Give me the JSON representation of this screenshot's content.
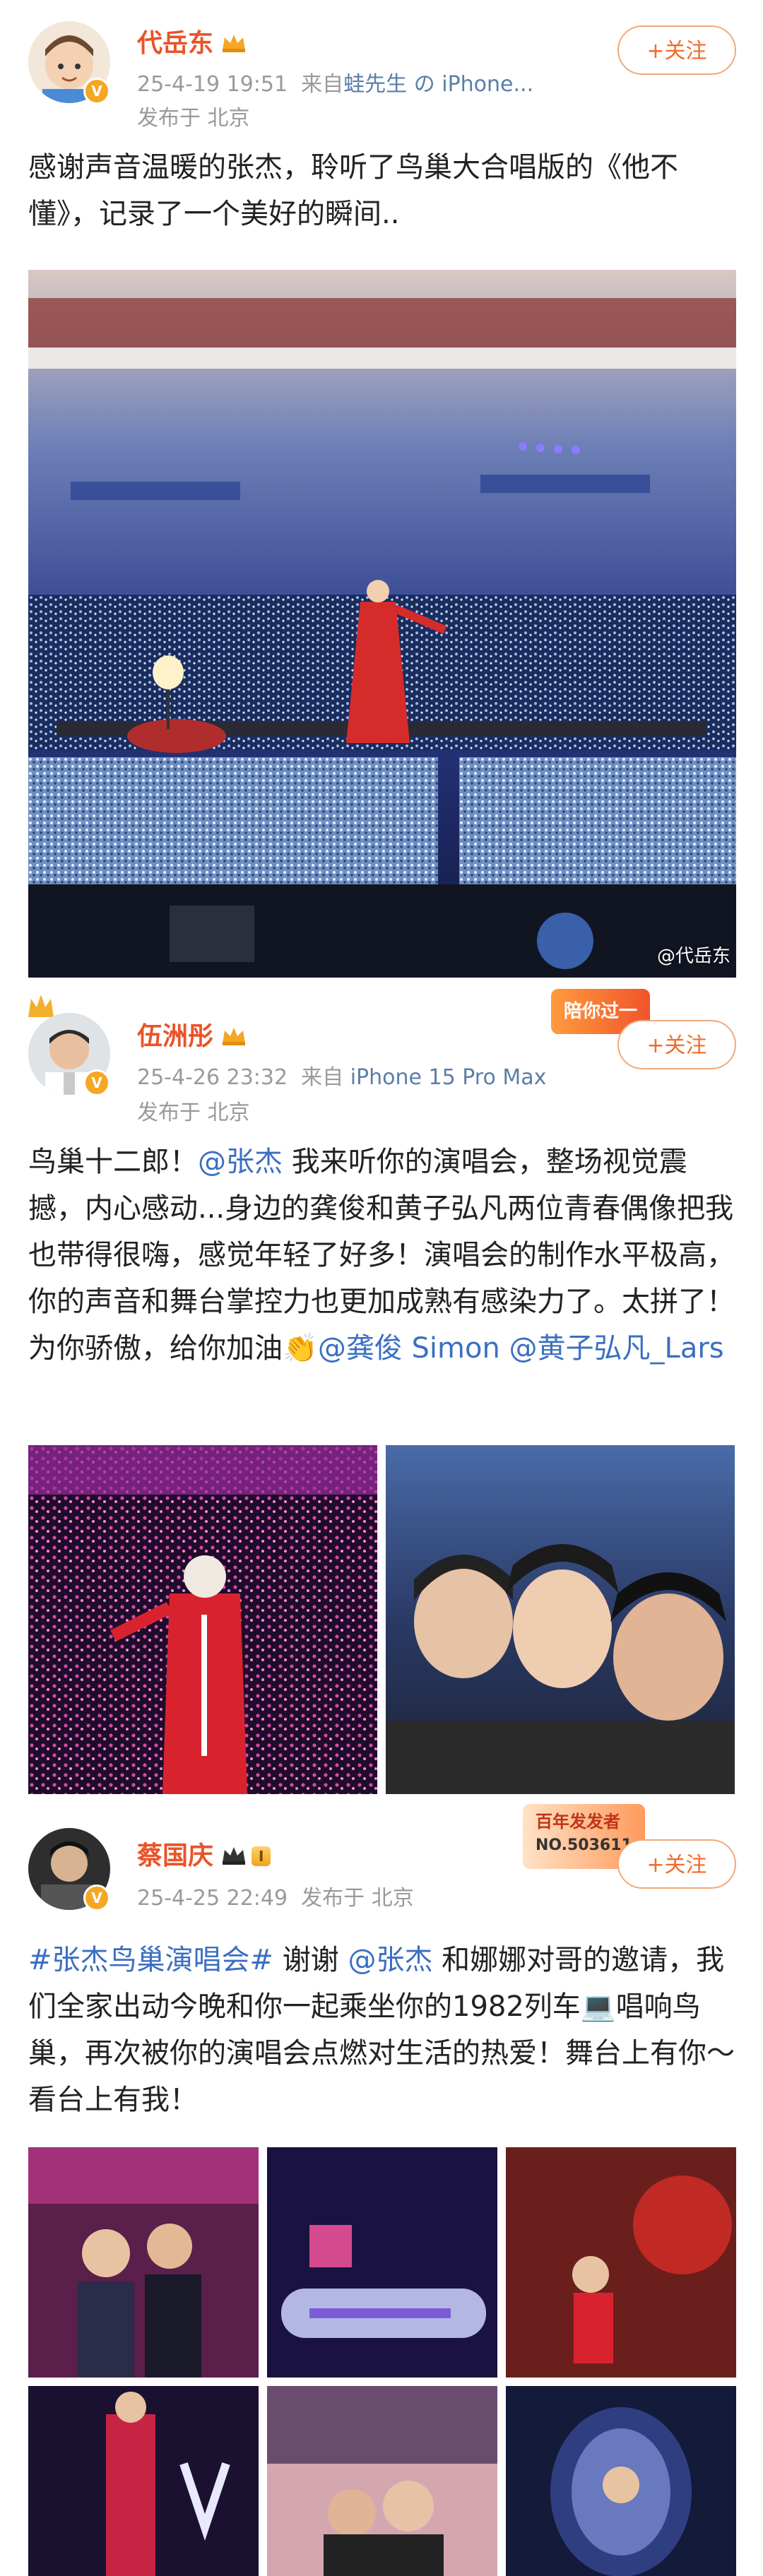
{
  "colors": {
    "name": "#e8542a",
    "link": "#3b6fc2",
    "meta": "#9a9a9a",
    "follow": "#f26b2a"
  },
  "posts": [
    {
      "username": "代岳东",
      "time": "25-4-19 19:51",
      "source_prefix": "来自",
      "source": "蛙先生 の iPhone...",
      "location": "发布于 北京",
      "follow_label": "+关注",
      "text": "感谢声音温暖的张杰，聆听了鸟巢大合唱版的《他不懂》，记录了一个美好的瞬间..",
      "watermark": "@代岳东"
    },
    {
      "username": "伍洲彤",
      "time": "25-4-26 23:32",
      "source_prefix": "来自",
      "source": "iPhone 15 Pro Max",
      "location": "发布于 北京",
      "follow_label": "+关注",
      "banner": "陪你过一",
      "text_parts": [
        "鸟巢十二郎！",
        "@张杰",
        " 我来听你的演唱会，整场视觉震撼，内心感动...身边的龚俊和黄子弘凡两位青春偶像把我也带得很嗨，感觉年轻了好多！演唱会的制作水平极高，你的声音和舞台掌控力也更加成熟有感染力了。太拼了！为你骄傲，给你加油👏",
        "@龚俊 Simon",
        " ",
        "@黄子弘凡_Lars"
      ]
    },
    {
      "username": "蔡国庆",
      "level": "I",
      "time": "25-4-25 22:49",
      "location": "发布于 北京",
      "follow_label": "+关注",
      "banner": "百年发发者",
      "banner_no": "NO.503611",
      "text_parts": [
        "#张杰鸟巢演唱会#",
        " 谢谢 ",
        "@张杰",
        " 和娜娜对哥的邀请，我们全家出动今晚和你一起乘坐你的1982列车💻唱响鸟巢，再次被你的演唱会点燃对生活的热爱！舞台上有你～看台上有我！"
      ]
    }
  ]
}
